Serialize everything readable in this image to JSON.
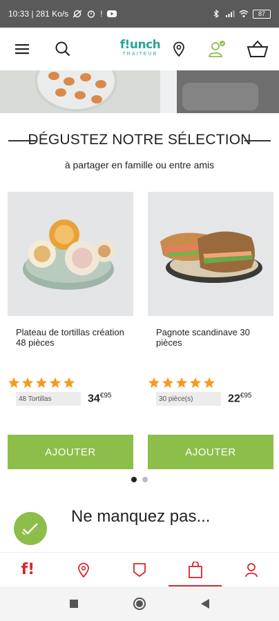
{
  "status_bar": {
    "time_speed": "10:33 | 281 Ko/s",
    "battery": "87"
  },
  "header": {
    "brand": "f!unch",
    "brand_sub": "TRAITEUR",
    "icons": [
      "menu-icon",
      "search-icon",
      "location-icon",
      "user-icon",
      "basket-icon"
    ],
    "brand_color": "#2aa39a"
  },
  "section": {
    "title": "DÉGUSTEZ NOTRE SÉLECTION",
    "subtitle": "à partager en famille ou entre amis"
  },
  "products": [
    {
      "title": "Plateau de tortillas création 48 pièces",
      "rating": 5,
      "quantity": "48 Tortillas",
      "price_main": "34",
      "price_cents": "€95",
      "button": "AJOUTER"
    },
    {
      "title": "Pagnote scandinave 30 pièces",
      "rating": 5,
      "quantity": "30 pièce(s)",
      "price_main": "22",
      "price_cents": "€95",
      "button": "AJOUTER"
    }
  ],
  "carousel": {
    "pages": 2,
    "active": 0
  },
  "teaser": {
    "text": "Ne manquez pas..."
  },
  "bottom_nav": {
    "items": [
      "home-logo",
      "location-icon",
      "offers-icon",
      "bag-icon",
      "account-icon"
    ],
    "active": 3
  },
  "colors": {
    "accent_green": "#8dbe4a",
    "star_orange": "#f39c1f",
    "nav_red": "#d7272e"
  }
}
